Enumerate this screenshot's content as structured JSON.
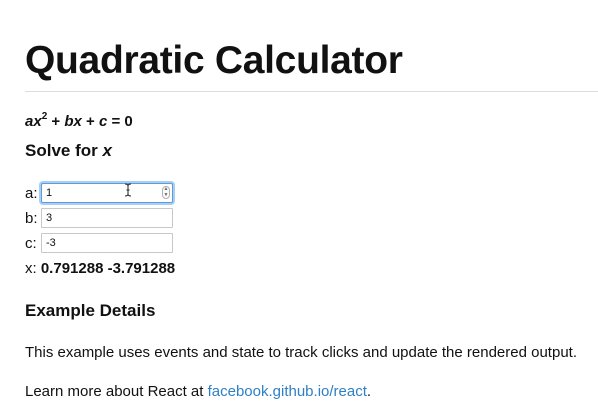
{
  "header": {
    "title": "Quadratic Calculator"
  },
  "equation": {
    "a": "ax",
    "exp": "2",
    "plus1": " + ",
    "b": "bx",
    "plus2": " + ",
    "c": "c",
    "eq": " = 0"
  },
  "solve": {
    "label": "Solve for ",
    "variable": "x"
  },
  "form": {
    "fields": [
      {
        "label": "a:",
        "value": "1"
      },
      {
        "label": "b:",
        "value": "3"
      },
      {
        "label": "c:",
        "value": "-3"
      }
    ],
    "result_label": "x:",
    "result_value": "0.791288 -3.791288"
  },
  "details": {
    "heading": "Example Details",
    "text": "This example uses events and state to track clicks and update the rendered output.",
    "learn_prefix": "Learn more about React at ",
    "link_text": "facebook.github.io/react",
    "learn_suffix": "."
  },
  "icons": {
    "spinner": "number-spinner-icon",
    "cursor": "text-cursor-icon"
  },
  "colors": {
    "link": "#2f7fc4",
    "focus": "#5b9dd9",
    "rule": "#dcdcdc"
  }
}
